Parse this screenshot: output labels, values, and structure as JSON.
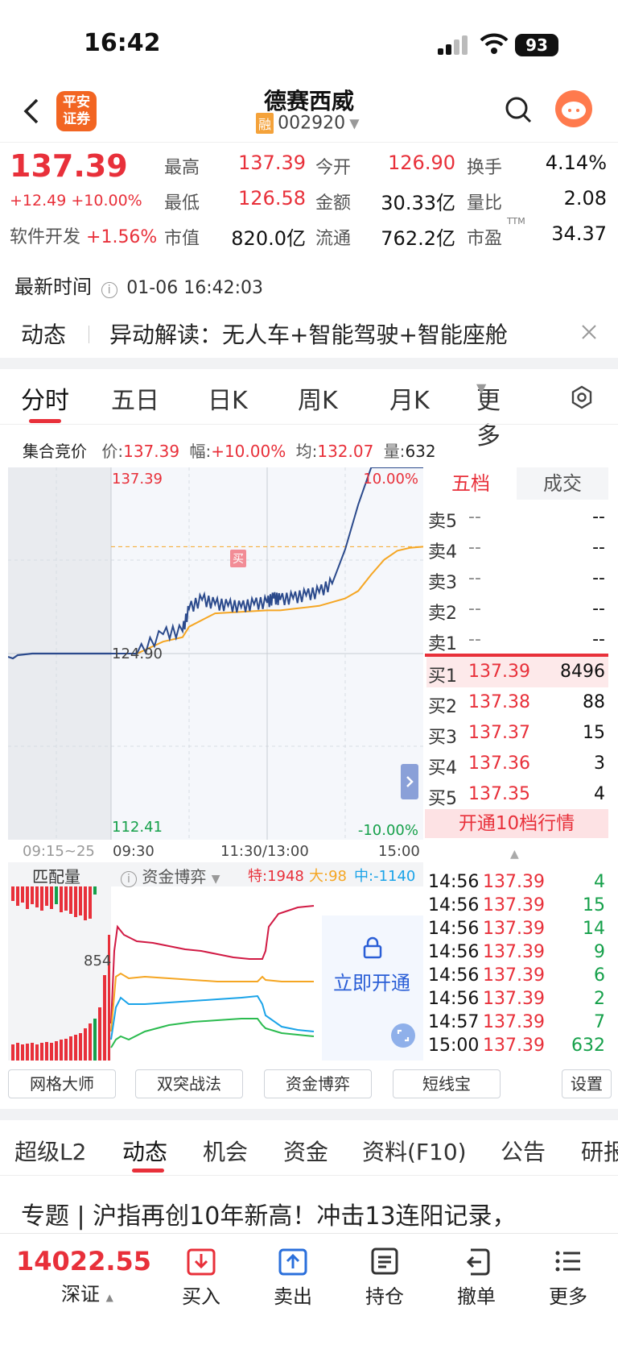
{
  "status_bar": {
    "time": "16:42",
    "battery": "93"
  },
  "header": {
    "title": "德赛西威",
    "rong_badge": "融",
    "code": "002920",
    "logo_line1": "平安",
    "logo_line2": "证券"
  },
  "quote": {
    "price": "137.39",
    "change": "+12.49 +10.00%",
    "sector": "软件开发",
    "sector_change": "+1.56%",
    "grid": [
      {
        "label": "最高",
        "value": "137.39",
        "color": "red"
      },
      {
        "label": "今开",
        "value": "126.90",
        "color": "red"
      },
      {
        "label": "换手",
        "value": "4.14%",
        "color": "black"
      },
      {
        "label": "最低",
        "value": "126.58",
        "color": "red"
      },
      {
        "label": "金额",
        "value": "30.33亿",
        "color": "black"
      },
      {
        "label": "量比",
        "value": "2.08",
        "color": "black"
      },
      {
        "label": "市值",
        "value": "820.0亿",
        "color": "black"
      },
      {
        "label": "流通",
        "value": "762.2亿",
        "color": "black"
      },
      {
        "label": "市盈",
        "value": "34.37",
        "color": "black"
      }
    ],
    "pe_sup": "TTM",
    "update_label": "最新时间",
    "update_time": "01-06 16:42:03"
  },
  "news_bar": {
    "tag": "动态",
    "text": "异动解读：无人车+智能驾驶+智能座舱"
  },
  "chart_tabs": [
    "分时",
    "五日",
    "日K",
    "周K",
    "月K",
    "更多"
  ],
  "auction": {
    "label": "集合竞价",
    "price_label": "价:",
    "price": "137.39",
    "amp_label": "幅:",
    "amp": "+10.00%",
    "avg_label": "均:",
    "avg": "132.07",
    "vol_label": "量:",
    "vol": "632"
  },
  "chart_data": {
    "type": "line",
    "x_ticks": [
      "09:15~25",
      "09:30",
      "11:30/13:00",
      "15:00"
    ],
    "y_top": "137.39",
    "y_mid": "124.90",
    "y_bottom": "112.41",
    "pct_top": "10.00%",
    "pct_bottom": "-10.00%",
    "ylim": [
      112.41,
      137.39
    ],
    "buy_marker": "买",
    "series": [
      {
        "name": "价",
        "color": "#2b4a8c",
        "x": [
          0,
          20,
          40,
          55,
          60,
          70,
          80,
          90,
          100,
          110,
          120,
          125,
          130,
          140,
          150,
          160,
          170,
          180,
          190,
          200,
          210,
          220,
          230,
          240
        ],
        "values": [
          124.9,
          124.9,
          126.2,
          126.4,
          127.9,
          128.5,
          128.2,
          128.1,
          128.0,
          128.2,
          128.3,
          128.6,
          128.5,
          128.6,
          128.8,
          129.0,
          129.6,
          131.9,
          134.9,
          137.39,
          137.39,
          137.39,
          137.39,
          137.39
        ]
      },
      {
        "name": "均",
        "color": "#f5a623",
        "x": [
          0,
          20,
          40,
          55,
          60,
          80,
          100,
          120,
          130,
          140,
          160,
          180,
          190,
          200,
          210,
          220,
          230,
          240
        ],
        "values": [
          124.9,
          124.9,
          125.7,
          126.0,
          126.7,
          127.6,
          127.7,
          127.8,
          127.8,
          127.9,
          128.1,
          128.6,
          129.1,
          130.2,
          131.2,
          131.8,
          132.0,
          132.07
        ]
      }
    ]
  },
  "sub_chart": {
    "tab1": "匹配量",
    "tab2": "资金博弈",
    "special_label": "特:",
    "special": "1948",
    "large_label": "大:",
    "large": "98",
    "mid_label": "中:",
    "mid": "-1140",
    "left_value": "854",
    "unlock": "立即开通"
  },
  "order_book": {
    "tab_level": "五档",
    "tab_trade": "成交",
    "sells": [
      {
        "k": "卖5",
        "p": "--",
        "q": "--"
      },
      {
        "k": "卖4",
        "p": "--",
        "q": "--"
      },
      {
        "k": "卖3",
        "p": "--",
        "q": "--"
      },
      {
        "k": "卖2",
        "p": "--",
        "q": "--"
      },
      {
        "k": "卖1",
        "p": "--",
        "q": "--"
      }
    ],
    "buys": [
      {
        "k": "买1",
        "p": "137.39",
        "q": "8496"
      },
      {
        "k": "买2",
        "p": "137.38",
        "q": "88"
      },
      {
        "k": "买3",
        "p": "137.37",
        "q": "15"
      },
      {
        "k": "买4",
        "p": "137.36",
        "q": "3"
      },
      {
        "k": "买5",
        "p": "137.35",
        "q": "4"
      }
    ],
    "upgrade": "开通10档行情"
  },
  "trades": [
    {
      "t": "14:56",
      "p": "137.39",
      "v": "4"
    },
    {
      "t": "14:56",
      "p": "137.39",
      "v": "15"
    },
    {
      "t": "14:56",
      "p": "137.39",
      "v": "14"
    },
    {
      "t": "14:56",
      "p": "137.39",
      "v": "9"
    },
    {
      "t": "14:56",
      "p": "137.39",
      "v": "6"
    },
    {
      "t": "14:56",
      "p": "137.39",
      "v": "2"
    },
    {
      "t": "14:57",
      "p": "137.39",
      "v": "7"
    },
    {
      "t": "15:00",
      "p": "137.39",
      "v": "632"
    }
  ],
  "tools": [
    "网格大师",
    "双突战法",
    "资金博弈",
    "短线宝",
    "设置"
  ],
  "bottom_tabs": [
    "超级L2",
    "动态",
    "机会",
    "资金",
    "资料(F10)",
    "公告",
    "研报"
  ],
  "news_headline": "专题 | 沪指再创10年新高！冲击13连阳记录，",
  "bottom_nav": {
    "index_value": "14022.55",
    "index_name": "深证",
    "buy": "买入",
    "sell": "卖出",
    "hold": "持仓",
    "cancel": "撤单",
    "more": "更多"
  }
}
